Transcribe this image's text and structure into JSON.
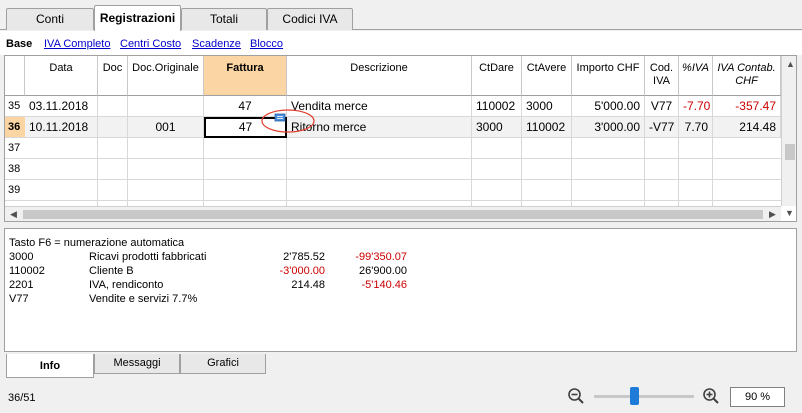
{
  "tabs": [
    "Conti",
    "Registrazioni",
    "Totali",
    "Codici IVA"
  ],
  "active_tab": "Registrazioni",
  "subnav": {
    "base": "Base",
    "links": [
      "IVA Completo",
      "Centri Costo",
      "Scadenze",
      "Blocco"
    ]
  },
  "table": {
    "headers": {
      "data": "Data",
      "doc": "Doc",
      "doc_orig": "Doc.Originale",
      "fattura": "Fattura",
      "descrizione": "Descrizione",
      "ctdare": "CtDare",
      "ctavere": "CtAvere",
      "importo": "Importo CHF",
      "cod_iva_1": "Cod.",
      "cod_iva_2": "IVA",
      "piva": "%IVA",
      "iva_contab_1": "IVA Contab.",
      "iva_contab_2": "CHF"
    },
    "rows": [
      {
        "num": "35",
        "data": "03.11.2018",
        "doc": "",
        "doc_orig": "",
        "fattura": "47",
        "descrizione": "Vendita merce",
        "ctdare": "110002",
        "ctavere": "3000",
        "importo": "5'000.00",
        "cod_iva": "V77",
        "piva": "-7.70",
        "iva_contab": "-357.47"
      },
      {
        "num": "36",
        "data": "10.11.2018",
        "doc": "",
        "doc_orig": "001",
        "fattura": "47",
        "descrizione": "Ritorno merce",
        "ctdare": "3000",
        "ctavere": "110002",
        "importo": "3'000.00",
        "cod_iva": "-V77",
        "piva": "7.70",
        "iva_contab": "214.48"
      },
      {
        "num": "37"
      },
      {
        "num": "38"
      },
      {
        "num": "39"
      }
    ]
  },
  "info": {
    "hint": "Tasto F6 = numerazione automatica",
    "lines": [
      {
        "code": "3000",
        "desc": "Ricavi prodotti fabbricati",
        "amount": "2'785.52",
        "balance": "-99'350.07"
      },
      {
        "code": "110002",
        "desc": "Cliente B",
        "amount": "-3'000.00",
        "balance": "26'900.00"
      },
      {
        "code": "2201",
        "desc": "IVA, rendiconto",
        "amount": "214.48",
        "balance": "-5'140.46"
      },
      {
        "code": "V77",
        "desc": "Vendite e servizi 7.7%",
        "amount": "",
        "balance": ""
      }
    ]
  },
  "bottom_tabs": [
    "Info",
    "Messaggi",
    "Grafici"
  ],
  "status": {
    "row_count": "36/51",
    "zoom": "90  %",
    "zoom_level": 0.4
  },
  "colors": {
    "highlight": "#fbd5a3",
    "negative": "#cc0000",
    "link": "#0000cc"
  }
}
